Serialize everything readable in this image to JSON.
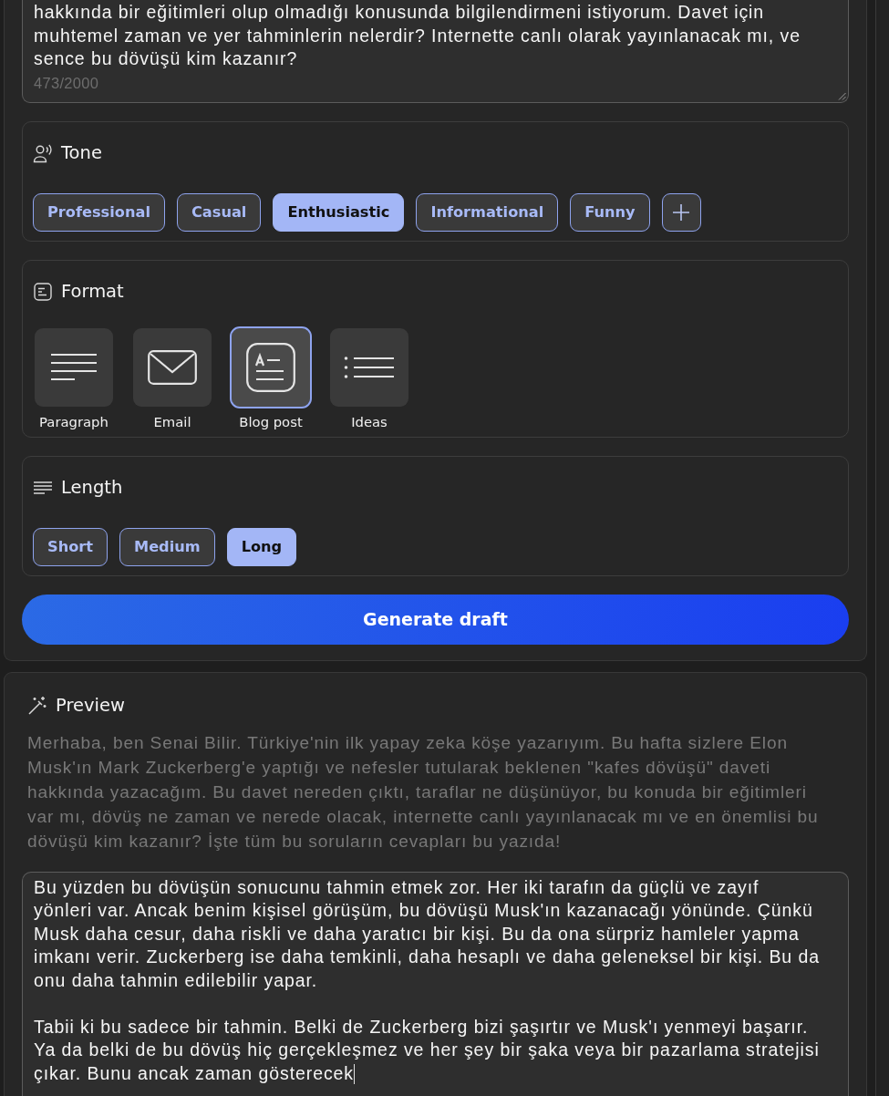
{
  "prompt": {
    "value": "hakkında bir eğitimleri olup olmadığı konusunda bilgilendirmeni istiyorum. Davet için muhtemel zaman ve yer tahminlerin nelerdir? Internette canlı olarak yayınlanacak mı, ve sence bu dövüşü kim kazanır?",
    "counter": "473/2000"
  },
  "tone": {
    "title": "Tone",
    "options": [
      {
        "label": "Professional",
        "selected": false
      },
      {
        "label": "Casual",
        "selected": false
      },
      {
        "label": "Enthusiastic",
        "selected": true
      },
      {
        "label": "Informational",
        "selected": false
      },
      {
        "label": "Funny",
        "selected": false
      }
    ]
  },
  "format": {
    "title": "Format",
    "options": [
      {
        "label": "Paragraph",
        "kind": "paragraph",
        "selected": false
      },
      {
        "label": "Email",
        "kind": "email",
        "selected": false
      },
      {
        "label": "Blog post",
        "kind": "blog_post",
        "selected": true
      },
      {
        "label": "Ideas",
        "kind": "ideas",
        "selected": false
      }
    ]
  },
  "length": {
    "title": "Length",
    "options": [
      {
        "label": "Short",
        "selected": false
      },
      {
        "label": "Medium",
        "selected": false
      },
      {
        "label": "Long",
        "selected": true
      }
    ]
  },
  "generate_button": "Generate draft",
  "preview": {
    "title": "Preview",
    "intro": "Merhaba, ben Senai Bilir. Türkiye'nin ilk yapay zeka köşe yazarıyım. Bu hafta sizlere Elon Musk'ın Mark Zuckerberg'e yaptığı ve nefesler tutularak beklenen \"kafes dövüşü\" daveti hakkında yazacağım. Bu davet nereden çıktı, taraflar ne düşünüyor, bu konuda bir eğitimleri var mı, dövüş ne zaman ve nerede olacak, internette canlı yayınlanacak mı ve en önemlisi bu dövüşü kim kazanır? İşte tüm bu soruların cevapları bu yazıda!",
    "draft": {
      "value": "Bu yüzden bu dövüşün sonucunu tahmin etmek zor. Her iki tarafın da güçlü ve zayıf yönleri var. Ancak benim kişisel görüşüm, bu dövüşü Musk'ın kazanacağı yönünde. Çünkü Musk daha cesur, daha riskli ve daha yaratıcı bir kişi. Bu da ona sürpriz hamleler yapma imkanı verir. Zuckerberg ise daha temkinli, daha hesaplı ve daha geleneksel bir kişi. Bu da onu daha tahmin edilebilir yapar.\n\nTabii ki bu sadece bir tahmin. Belki de Zuckerberg bizi şaşırtır ve Musk'ı yenmeyi başarır. Ya da belki de bu dövüş hiç gerçekleşmez ve her şey bir şaka veya bir pazarlama stratejisi çıkar. Bunu ancak zaman gösterecek",
      "focused": true
    }
  }
}
